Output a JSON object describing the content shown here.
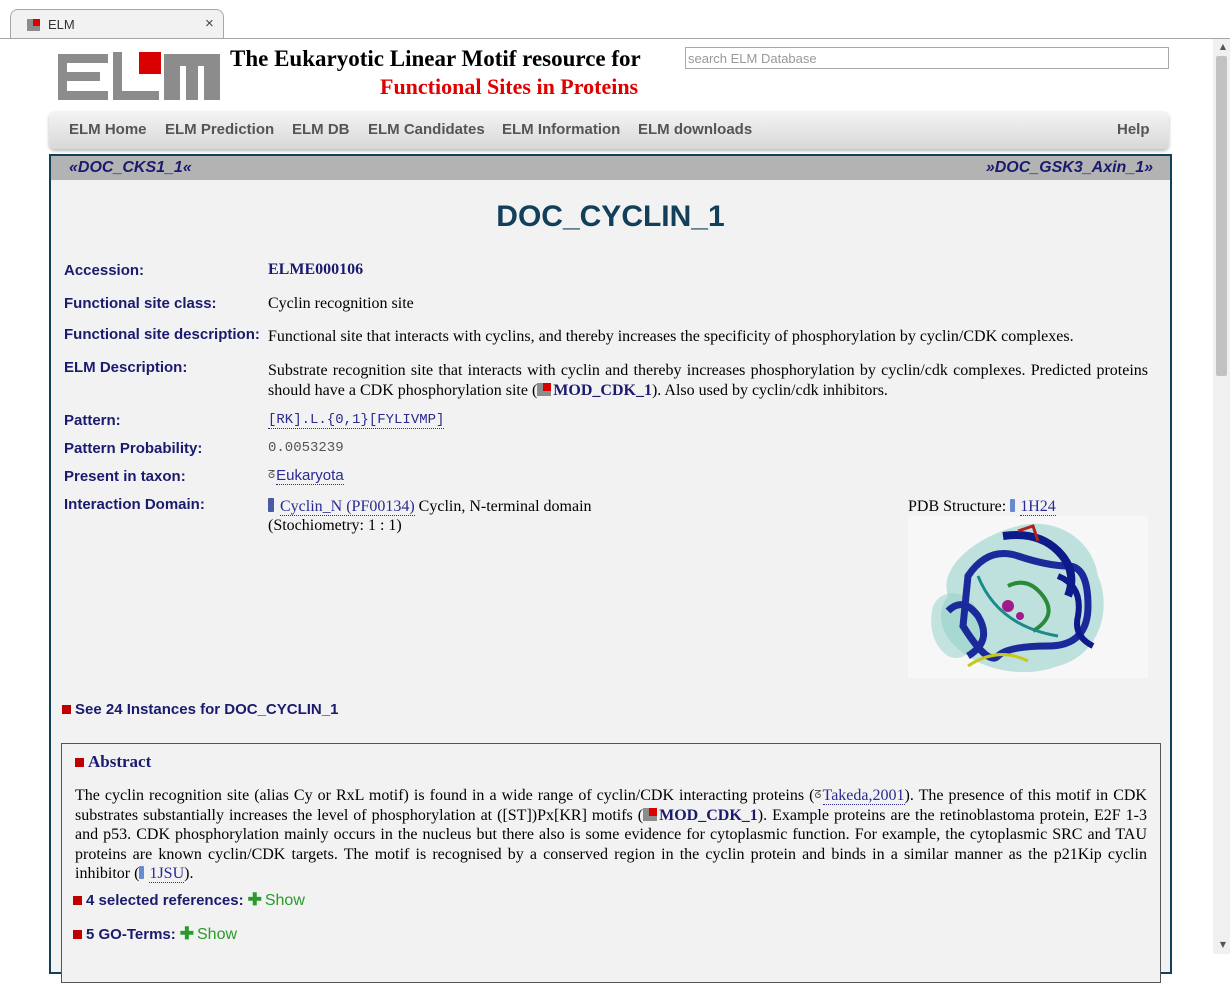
{
  "browser": {
    "tab_title": "ELM",
    "tab_close": "×"
  },
  "header": {
    "title_line1": "The Eukaryotic Linear Motif resource for",
    "title_line2": "Functional Sites in Proteins",
    "search_placeholder": "search ELM Database"
  },
  "nav": {
    "items": [
      "ELM Home",
      "ELM Prediction",
      "ELM DB",
      "ELM Candidates",
      "ELM Information",
      "ELM downloads"
    ],
    "help": "Help"
  },
  "prevnext": {
    "prev": "«DOC_CKS1_1«",
    "next": "»DOC_GSK3_Axin_1»"
  },
  "entry": {
    "name": "DOC_CYCLIN_1",
    "fields": {
      "accession_label": "Accession:",
      "accession_value": "ELME000106",
      "class_label": "Functional site class:",
      "class_value": "Cyclin recognition site",
      "fdesc_label": "Functional site description:",
      "fdesc_value": "Functional site that interacts with cyclins, and thereby increases the specificity of phosphorylation by cyclin/CDK complexes.",
      "edesc_label": "ELM Description:",
      "edesc_part1": "Substrate recognition site that interacts with cyclin and thereby increases phosphorylation by cyclin/cdk complexes. Predicted proteins should have a CDK phosphorylation site (",
      "edesc_link": "MOD_CDK_1",
      "edesc_part2": "). Also used by cyclin/cdk inhibitors.",
      "pattern_label": "Pattern:",
      "pattern_value": "[RK].L.{0,1}[FYLIVMP]",
      "prob_label": "Pattern Probability:",
      "prob_value": "0.0053239",
      "taxon_label": "Present in taxon:",
      "taxon_value": "Eukaryota",
      "domain_label": "Interaction Domain:",
      "domain_link": "Cyclin_N (PF00134)",
      "domain_desc": "Cyclin, N-terminal domain",
      "stoich": "(Stochiometry: 1 : 1)",
      "pdb_label": "PDB Structure:",
      "pdb_value": "1H24"
    },
    "instances": "See 24 Instances for DOC_CYCLIN_1"
  },
  "abstract": {
    "heading": "Abstract",
    "t1": "The cyclin recognition site (alias Cy or RxL motif) is found in a wide range of cyclin/CDK interacting proteins (",
    "ref": "Takeda,2001",
    "t2": "). The presence of this motif in CDK substrates substantially increases the level of phosphorylation at ([ST])Px[KR] motifs (",
    "link": "MOD_CDK_1",
    "t3": "). Example proteins are the retinoblastoma protein, E2F 1-3 and p53. CDK phosphorylation mainly occurs in the nucleus but there also is some evidence for cytoplasmic function. For example, the cytoplasmic SRC and TAU proteins are known cyclin/CDK targets. The motif is recognised by a conserved region in the cyclin protein and binds in a similar manner as the p21Kip cyclin inhibitor (",
    "pdb": "1JSU",
    "t4": ").",
    "refs_label": "4 selected references:",
    "go_label": "5 GO-Terms:",
    "show": "Show"
  },
  "colors": {
    "brand_red": "#e00000",
    "navy": "#1a1a6e",
    "panel_border": "#12405a",
    "show_green": "#2a9a2a"
  }
}
